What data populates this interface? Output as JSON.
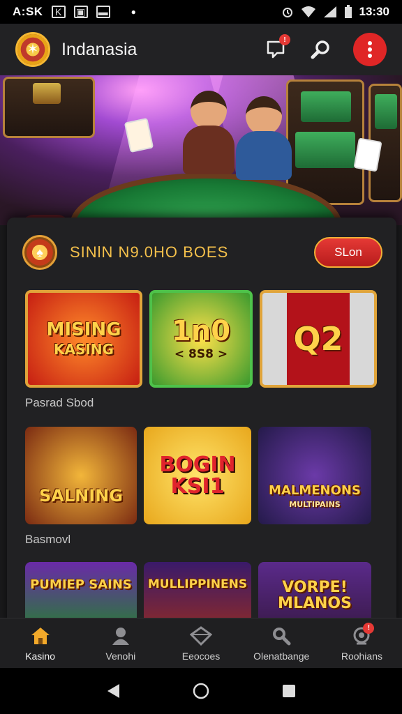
{
  "status_bar": {
    "left_time": "A:SK",
    "clock": "13:30"
  },
  "app_bar": {
    "title": "Indanasia",
    "notification_count": "!"
  },
  "section": {
    "title": "SINlN N9.0HO BOES",
    "button_label": "SLon"
  },
  "rows": [
    {
      "label": "Pasrad Sbod",
      "tiles": [
        {
          "text": "MISING",
          "sub": "KASING"
        },
        {
          "text": "1n0",
          "sub": "< 8S8 >"
        },
        {
          "text": "Q2",
          "sub": ""
        }
      ]
    },
    {
      "label": "Basmovl",
      "tiles": [
        {
          "text": "SALNING",
          "sub": ""
        },
        {
          "text": "BOGIN KSI1",
          "sub": ""
        },
        {
          "text": "MALMENONS",
          "sub": "MULTIPAINS"
        }
      ]
    },
    {
      "label": "",
      "tiles": [
        {
          "text": "PUMIEP SAINS",
          "sub": ""
        },
        {
          "text": "MULLIPPINENS",
          "sub": ""
        },
        {
          "text": "VORPE! MLANOS",
          "sub": ""
        }
      ]
    }
  ],
  "bottom_nav": [
    {
      "label": "Kasino",
      "icon": "home-icon",
      "active": true
    },
    {
      "label": "Venohi",
      "icon": "user-icon",
      "active": false
    },
    {
      "label": "Eeocoes",
      "icon": "diamond-icon",
      "active": false
    },
    {
      "label": "Olenatbange",
      "icon": "search-icon",
      "active": false
    },
    {
      "label": "Roohians",
      "icon": "support-icon",
      "active": false,
      "badge": "!"
    }
  ],
  "colors": {
    "accent_red": "#e02626",
    "gold": "#f4c04b",
    "panel_bg": "#212123"
  }
}
